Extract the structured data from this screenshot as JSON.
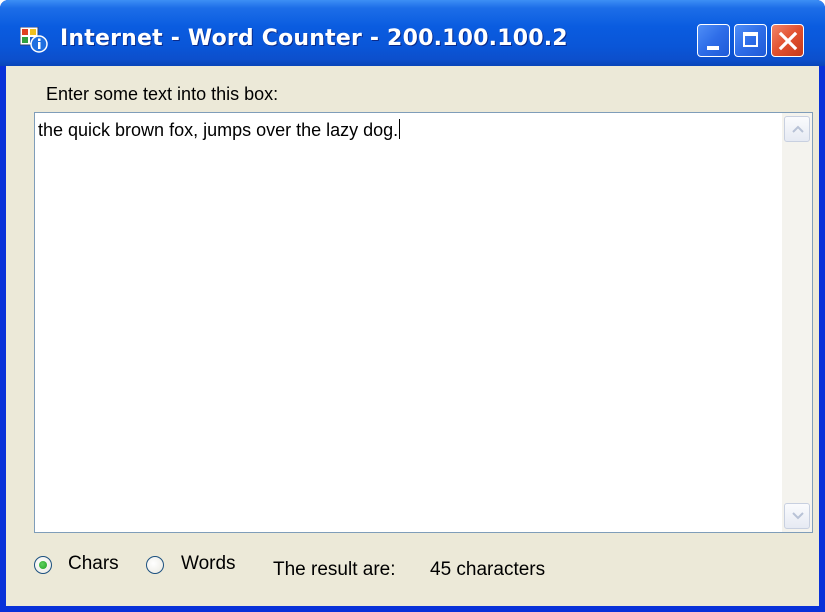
{
  "window": {
    "title": "Internet - Word Counter - 200.100.100.2",
    "app_icon": "app-window-icon",
    "controls": [
      {
        "name": "minimize",
        "icon": "minimize-icon"
      },
      {
        "name": "maximize",
        "icon": "maximize-icon"
      },
      {
        "name": "close",
        "icon": "close-icon"
      }
    ]
  },
  "form": {
    "prompt_label": "Enter some text into this box:",
    "text_value": "the quick brown fox, jumps over the lazy dog.",
    "options": [
      {
        "label": "Chars",
        "selected": true
      },
      {
        "label": "Words",
        "selected": false
      }
    ],
    "result_label": "The result are:",
    "result_value": "45 characters"
  },
  "colors": {
    "titlebar_blue": "#0a56d8",
    "client_background": "#ece9d8",
    "close_button_red": "#e2502e",
    "textbox_border": "#7f9db9",
    "radio_selected_green": "#21a121"
  }
}
